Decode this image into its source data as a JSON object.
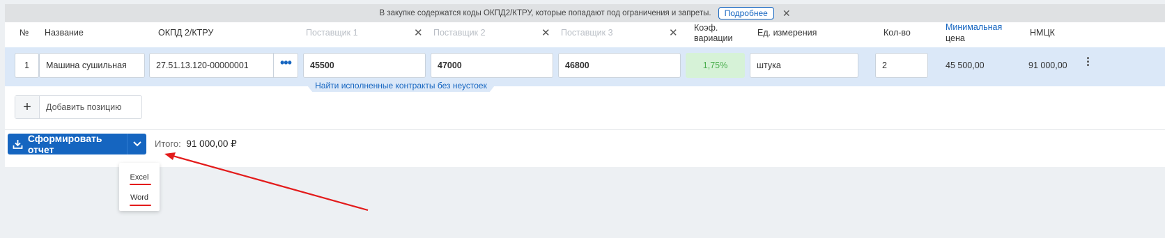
{
  "notice": {
    "text": "В закупке содержатся коды ОКПД2/КТРУ, которые попадают под ограничения и запреты.",
    "more_label": "Подробнее",
    "close": "✕"
  },
  "headers": {
    "num": "№",
    "name": "Название",
    "okpd": "ОКПД 2/КТРУ",
    "supplier1": "Поставщик 1",
    "supplier2": "Поставщик 2",
    "supplier3": "Поставщик 3",
    "coef_line1": "Коэф.",
    "coef_line2": "вариации",
    "unit": "Ед. измерения",
    "qty": "Кол-во",
    "min_line1": "Минимальная",
    "min_line2": "цена",
    "nmck": "НМЦК",
    "close_icon": "✕"
  },
  "row": {
    "num": "1",
    "name": "Машина сушильная",
    "okpd": "27.51.13.120-00000001",
    "okpd_menu": "•••",
    "supplier1": "45500",
    "supplier2": "47000",
    "supplier3": "46800",
    "coef": "1,75%",
    "unit": "штука",
    "qty": "2",
    "min_price": "45 500,00",
    "nmck": "91 000,00"
  },
  "find_contracts_link": "Найти исполненные контракты без неустоек",
  "add_position": {
    "plus": "+",
    "label": "Добавить позицию"
  },
  "footer": {
    "report_button": "Сформировать отчет",
    "total_label": "Итого:",
    "total_value": "91 000,00 ₽"
  },
  "dropdown": {
    "items": [
      "Excel",
      "Word"
    ]
  },
  "colors": {
    "accent": "#1565c0",
    "row_highlight": "#dbe8f8",
    "coef_bg": "#d6f2d7",
    "coef_text": "#4cae4f",
    "annotation": "#e31b1b"
  }
}
